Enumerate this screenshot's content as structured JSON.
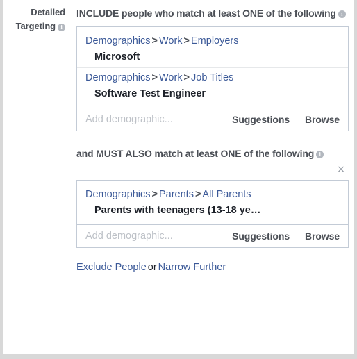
{
  "sidebar_label": {
    "line1": "Detailed",
    "line2": "Targeting",
    "info_icon": "info-icon"
  },
  "colors": {
    "link_blue": "#3b5998",
    "heading_gray": "#4b4f56",
    "value_dark": "#1d2129",
    "box_border": "#c3cbd6",
    "divider": "#e6e8ea",
    "placeholder_gray": "#bdc1c7",
    "page_frame": "#d8d8d8"
  },
  "include_section": {
    "heading": "INCLUDE people who match at least ONE of the following",
    "info_icon": "info-icon",
    "entries": [
      {
        "crumbs": [
          "Demographics",
          "Work",
          "Employers"
        ],
        "separator": ">",
        "value": "Microsoft"
      },
      {
        "crumbs": [
          "Demographics",
          "Work",
          "Job Titles"
        ],
        "separator": ">",
        "value": "Software Test Engineer"
      }
    ],
    "input": {
      "value": "",
      "placeholder": "Add demographic..."
    },
    "actions": {
      "suggestions": "Suggestions",
      "browse": "Browse"
    }
  },
  "must_also_section": {
    "heading": "and MUST ALSO match at least ONE of the following",
    "info_icon": "info-icon",
    "close_icon": "×",
    "entries": [
      {
        "crumbs": [
          "Demographics",
          "Parents",
          "All Parents"
        ],
        "separator": ">",
        "value": "Parents with teenagers (13-18 ye…"
      }
    ],
    "input": {
      "value": "",
      "placeholder": "Add demographic..."
    },
    "actions": {
      "suggestions": "Suggestions",
      "browse": "Browse"
    }
  },
  "footer": {
    "exclude_label": "Exclude People",
    "or_label": "or",
    "narrow_label": "Narrow Further"
  }
}
